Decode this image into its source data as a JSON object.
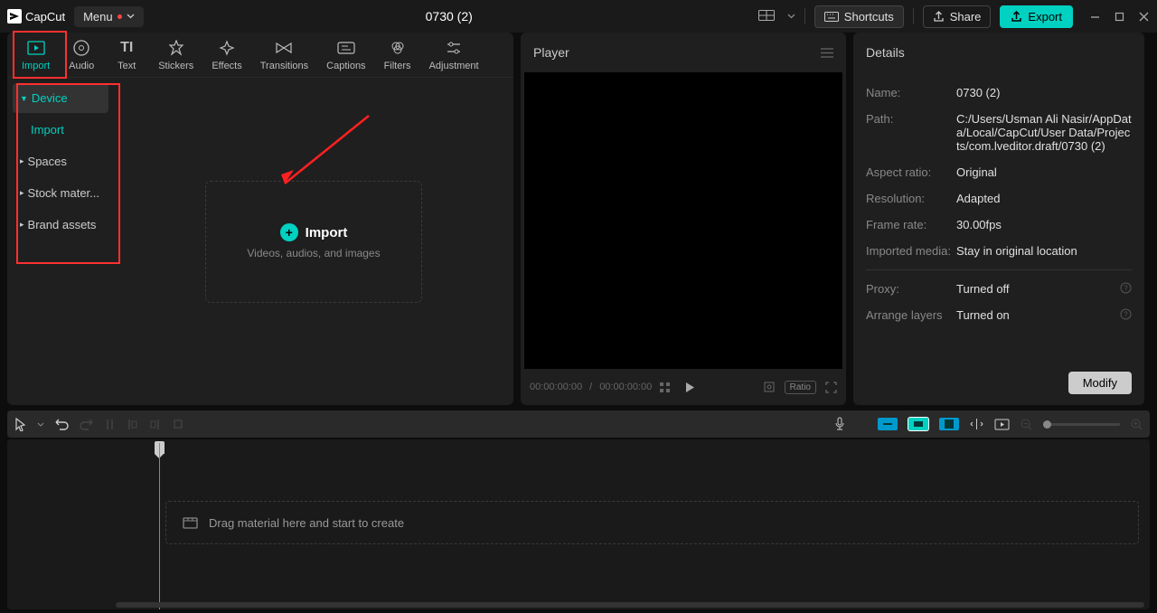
{
  "app": {
    "name": "CapCut"
  },
  "menu": {
    "label": "Menu"
  },
  "project": {
    "title": "0730 (2)"
  },
  "topbar": {
    "shortcuts": "Shortcuts",
    "share": "Share",
    "export": "Export"
  },
  "tabs": [
    {
      "id": "import",
      "label": "Import"
    },
    {
      "id": "audio",
      "label": "Audio"
    },
    {
      "id": "text",
      "label": "Text"
    },
    {
      "id": "stickers",
      "label": "Stickers"
    },
    {
      "id": "effects",
      "label": "Effects"
    },
    {
      "id": "transitions",
      "label": "Transitions"
    },
    {
      "id": "captions",
      "label": "Captions"
    },
    {
      "id": "filters",
      "label": "Filters"
    },
    {
      "id": "adjustment",
      "label": "Adjustment"
    }
  ],
  "sidebar": {
    "items": [
      {
        "label": "Device",
        "expanded": true,
        "active": true
      },
      {
        "label": "Import",
        "sub": true
      },
      {
        "label": "Spaces"
      },
      {
        "label": "Stock mater..."
      },
      {
        "label": "Brand assets"
      }
    ]
  },
  "importArea": {
    "title": "Import",
    "subtitle": "Videos, audios, and images"
  },
  "player": {
    "title": "Player",
    "time_current": "00:00:00:00",
    "time_total": "00:00:00:00",
    "ratio": "Ratio"
  },
  "details": {
    "title": "Details",
    "rows": {
      "name": {
        "label": "Name:",
        "value": "0730 (2)"
      },
      "path": {
        "label": "Path:",
        "value": "C:/Users/Usman Ali Nasir/AppData/Local/CapCut/User Data/Projects/com.lveditor.draft/0730 (2)"
      },
      "aspect": {
        "label": "Aspect ratio:",
        "value": "Original"
      },
      "resolution": {
        "label": "Resolution:",
        "value": "Adapted"
      },
      "framerate": {
        "label": "Frame rate:",
        "value": "30.00fps"
      },
      "imported": {
        "label": "Imported media:",
        "value": "Stay in original location"
      },
      "proxy": {
        "label": "Proxy:",
        "value": "Turned off"
      },
      "layers": {
        "label": "Arrange layers",
        "value": "Turned on"
      }
    },
    "modify": "Modify"
  },
  "timeline": {
    "drop_hint": "Drag material here and start to create"
  }
}
